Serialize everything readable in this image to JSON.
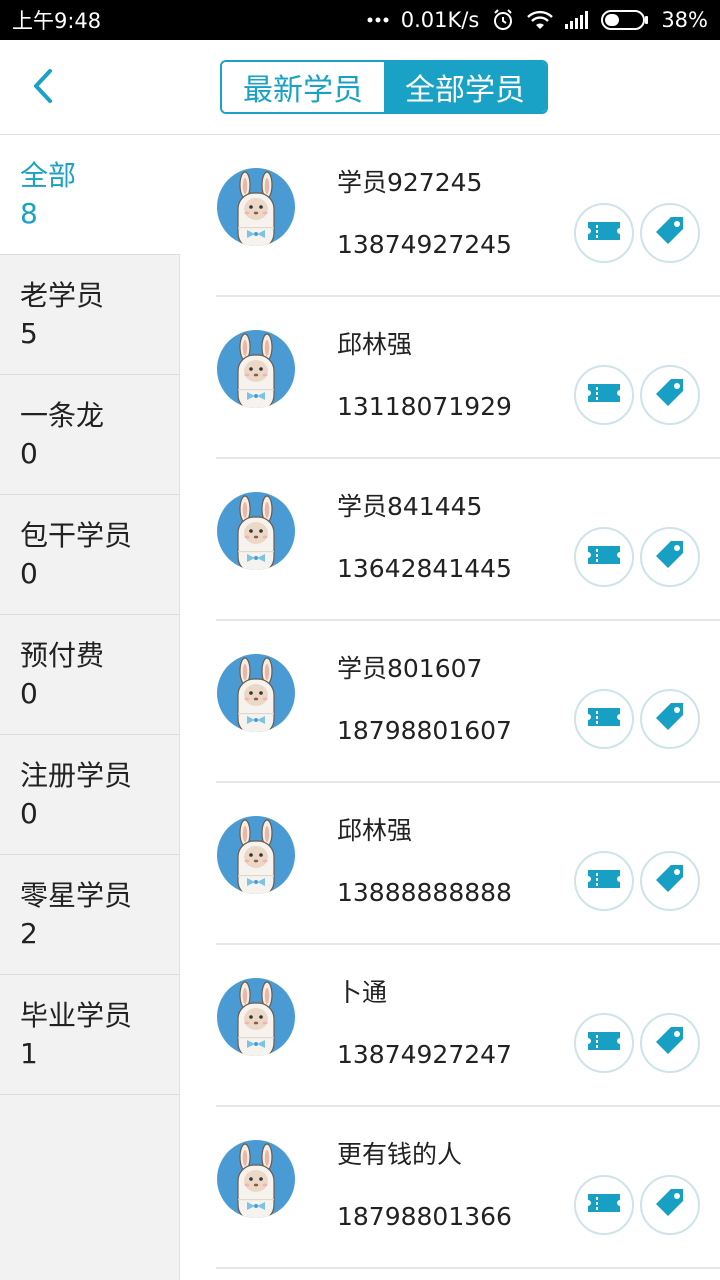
{
  "status_bar": {
    "time": "上午9:48",
    "network_speed": "0.01K/s",
    "battery": "38%",
    "battery_level": 0.38,
    "icons": [
      "dots-icon",
      "alarm-icon",
      "wifi-icon",
      "signal-icon",
      "battery-icon"
    ]
  },
  "header": {
    "back_icon": "chevron-left-icon",
    "tabs": [
      {
        "label": "最新学员",
        "active": false
      },
      {
        "label": "全部学员",
        "active": true
      }
    ],
    "accent_color": "#1aa2c6"
  },
  "sidebar": {
    "items": [
      {
        "label": "全部",
        "count": "8",
        "active": true
      },
      {
        "label": "老学员",
        "count": "5",
        "active": false
      },
      {
        "label": "一条龙",
        "count": "0",
        "active": false
      },
      {
        "label": "包干学员",
        "count": "0",
        "active": false
      },
      {
        "label": "预付费",
        "count": "0",
        "active": false
      },
      {
        "label": "注册学员",
        "count": "0",
        "active": false
      },
      {
        "label": "零星学员",
        "count": "2",
        "active": false
      },
      {
        "label": "毕业学员",
        "count": "1",
        "active": false
      }
    ]
  },
  "students": [
    {
      "name": "学员927245",
      "phone": "13874927245"
    },
    {
      "name": "邱林强",
      "phone": "13118071929"
    },
    {
      "name": "学员841445",
      "phone": "13642841445"
    },
    {
      "name": "学员801607",
      "phone": "18798801607"
    },
    {
      "name": "邱林强",
      "phone": "13888888888"
    },
    {
      "name": "卜通",
      "phone": "13874927247"
    },
    {
      "name": "更有钱的人",
      "phone": "18798801366"
    }
  ],
  "row_actions": {
    "ticket_icon": "ticket-icon",
    "tag_icon": "tag-icon"
  }
}
